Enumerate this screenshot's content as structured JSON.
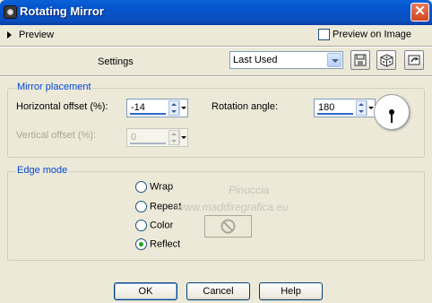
{
  "window": {
    "title": "Rotating Mirror",
    "close_label": "✕"
  },
  "preview": {
    "toggle_label": "Preview",
    "preview_on_image_label": "Preview on Image",
    "preview_on_image_checked": false
  },
  "settings": {
    "label": "Settings",
    "preset_value": "Last Used",
    "icons": [
      "save-preset-icon",
      "randomize-icon",
      "reset-icon"
    ]
  },
  "mirror_placement": {
    "title": "Mirror placement",
    "horizontal_label": "Horizontal offset (%):",
    "horizontal_value": "-14",
    "vertical_label": "Vertical offset (%):",
    "vertical_value": "0",
    "vertical_enabled": false,
    "rotation_label": "Rotation angle:",
    "rotation_value": "180"
  },
  "edge_mode": {
    "title": "Edge mode",
    "options": [
      {
        "label": "Wrap",
        "selected": false
      },
      {
        "label": "Repeat",
        "selected": false
      },
      {
        "label": "Color",
        "selected": false
      },
      {
        "label": "Reflect",
        "selected": true
      }
    ]
  },
  "watermark": {
    "line1": "Pinuccia",
    "line2": "www.maddiregrafica.eu"
  },
  "buttons": {
    "ok": "OK",
    "cancel": "Cancel",
    "help": "Help"
  },
  "colors": {
    "titlebar": "#0555cf",
    "legend": "#0046d5",
    "dialog_bg": "#ece9d8",
    "reflect_dot": "#21a121"
  }
}
